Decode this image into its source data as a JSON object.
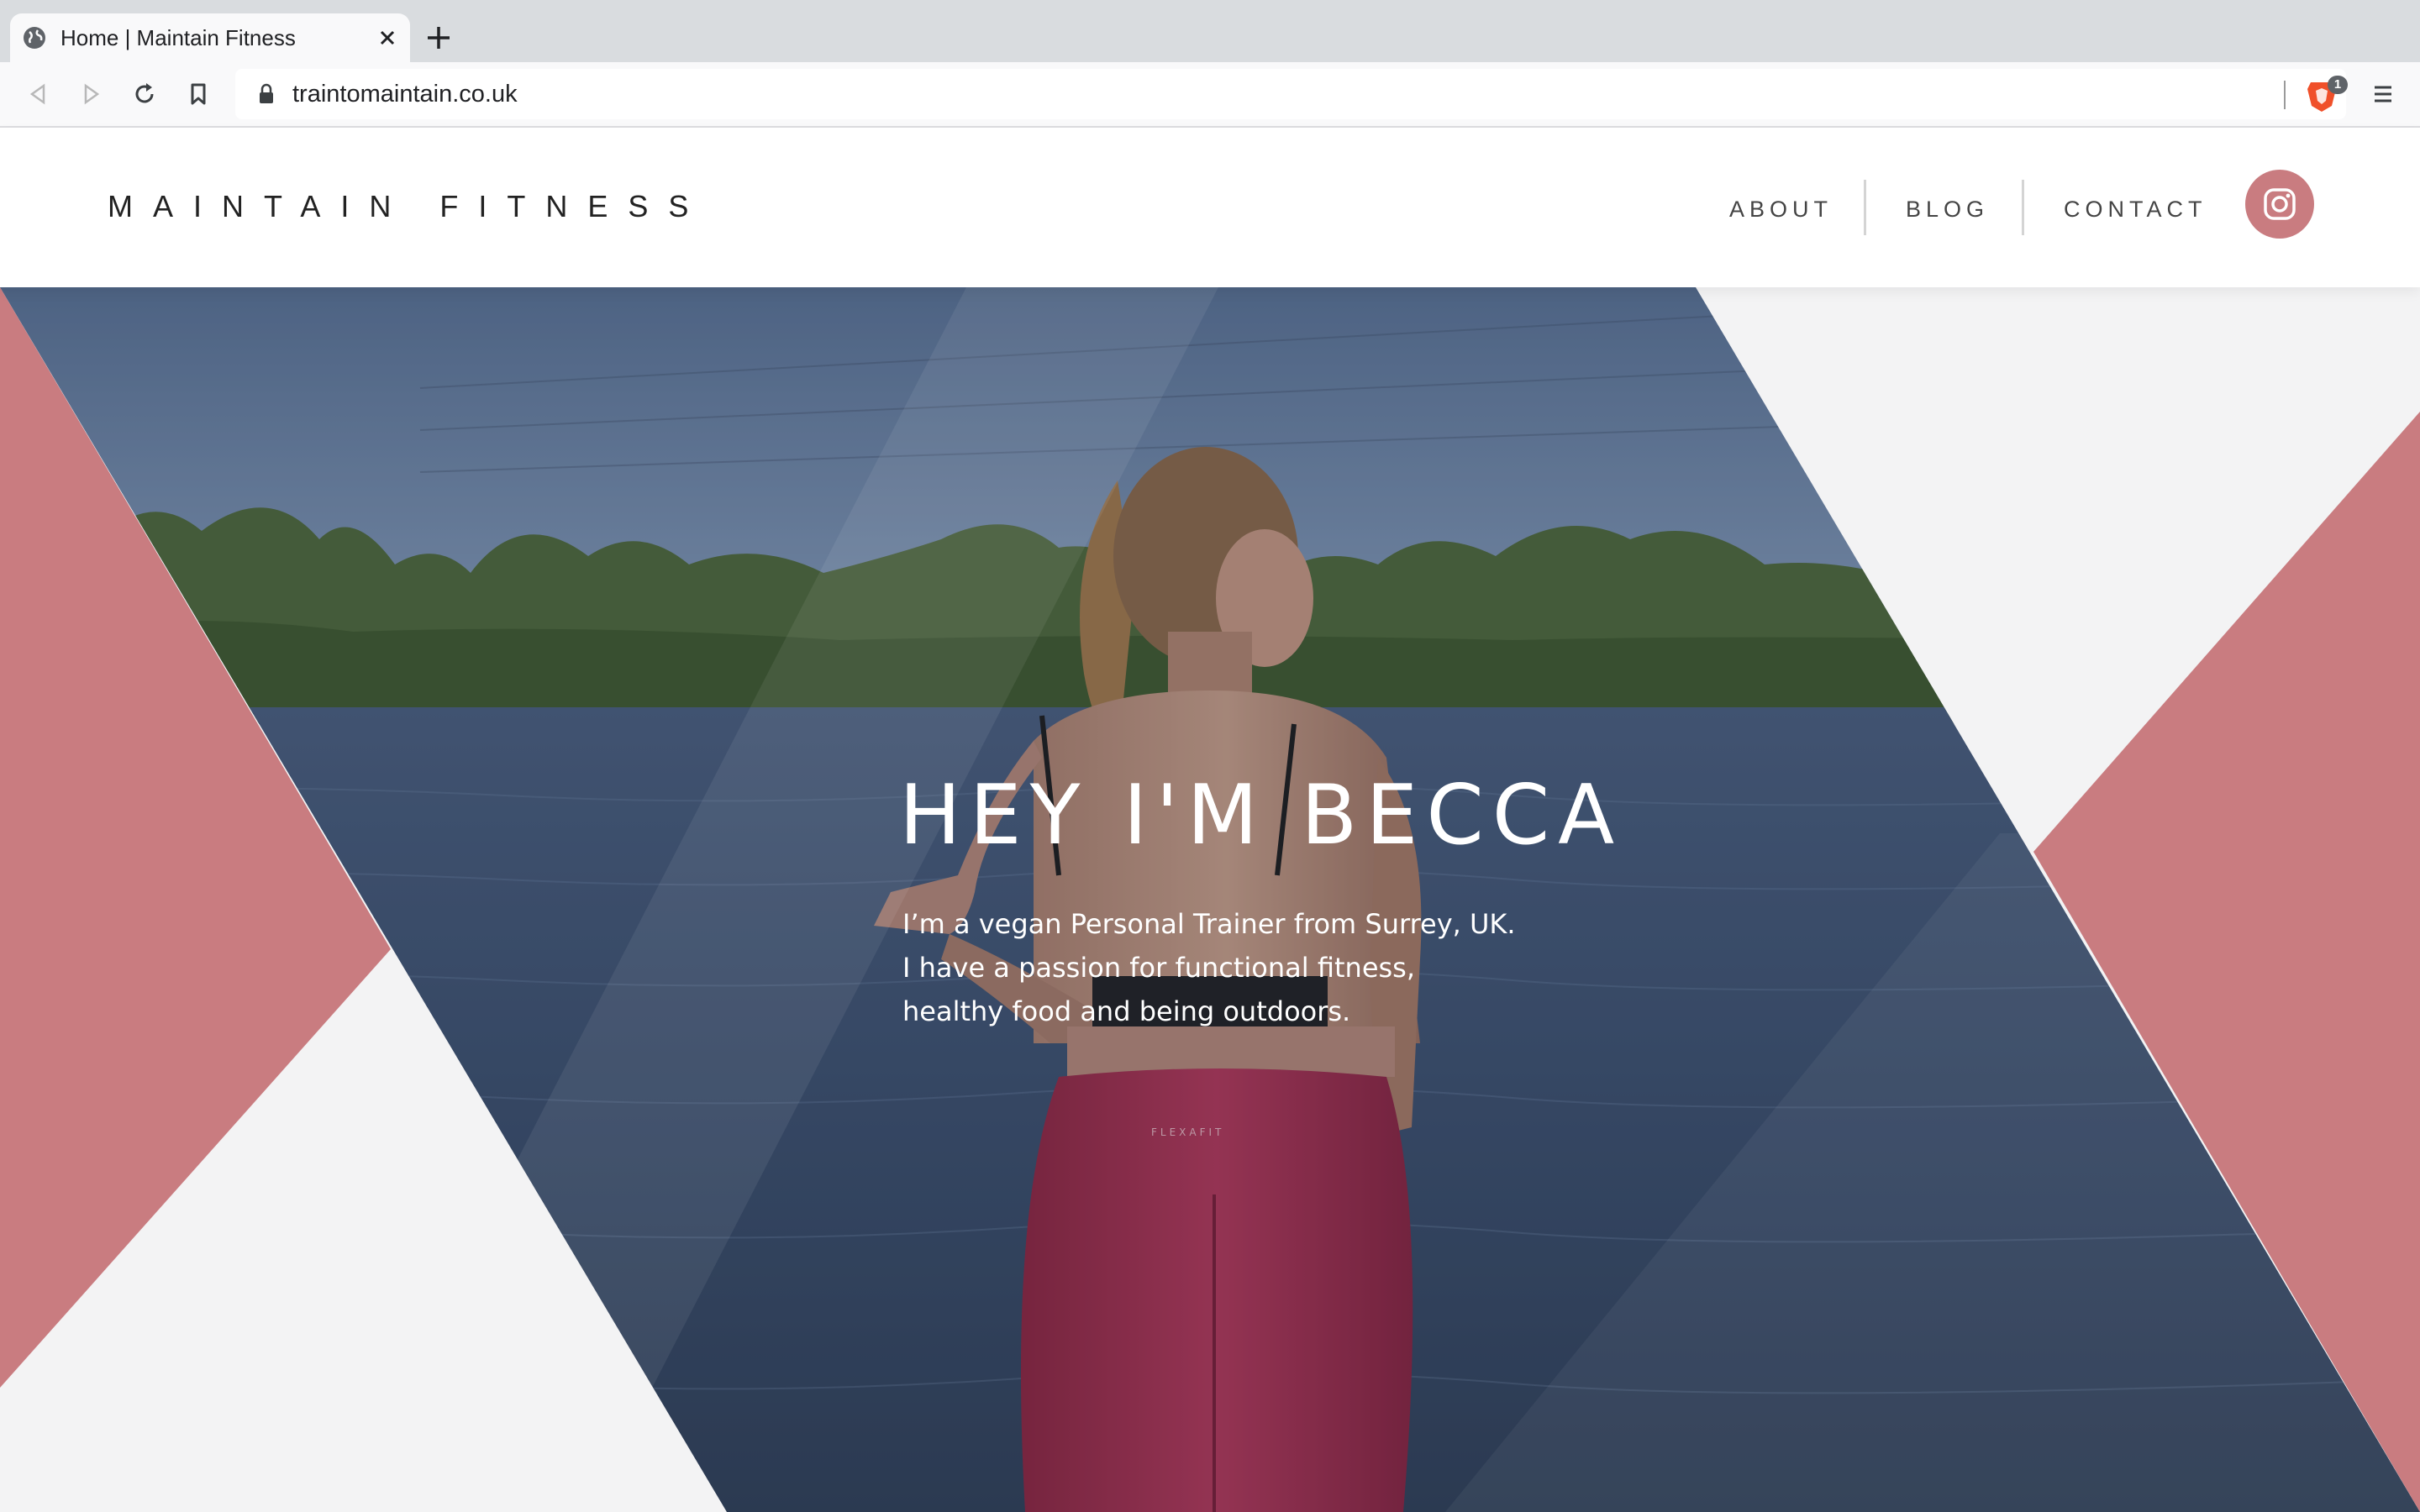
{
  "browser": {
    "tab_title": "Home | Maintain Fitness",
    "url": "traintomaintain.co.uk",
    "shield_count": "1"
  },
  "site": {
    "logo": "MAINTAIN FITNESS",
    "nav": [
      "ABOUT",
      "BLOG",
      "CONTACT"
    ],
    "accent_color": "#c97c80"
  },
  "hero": {
    "title": "HEY I'M BECCA",
    "text": "I’m a vegan Personal Trainer from Surrey, UK. I have a passion for functional fitness, healthy food and being outdoors.",
    "legging_brand": "FLEXAFIT"
  }
}
